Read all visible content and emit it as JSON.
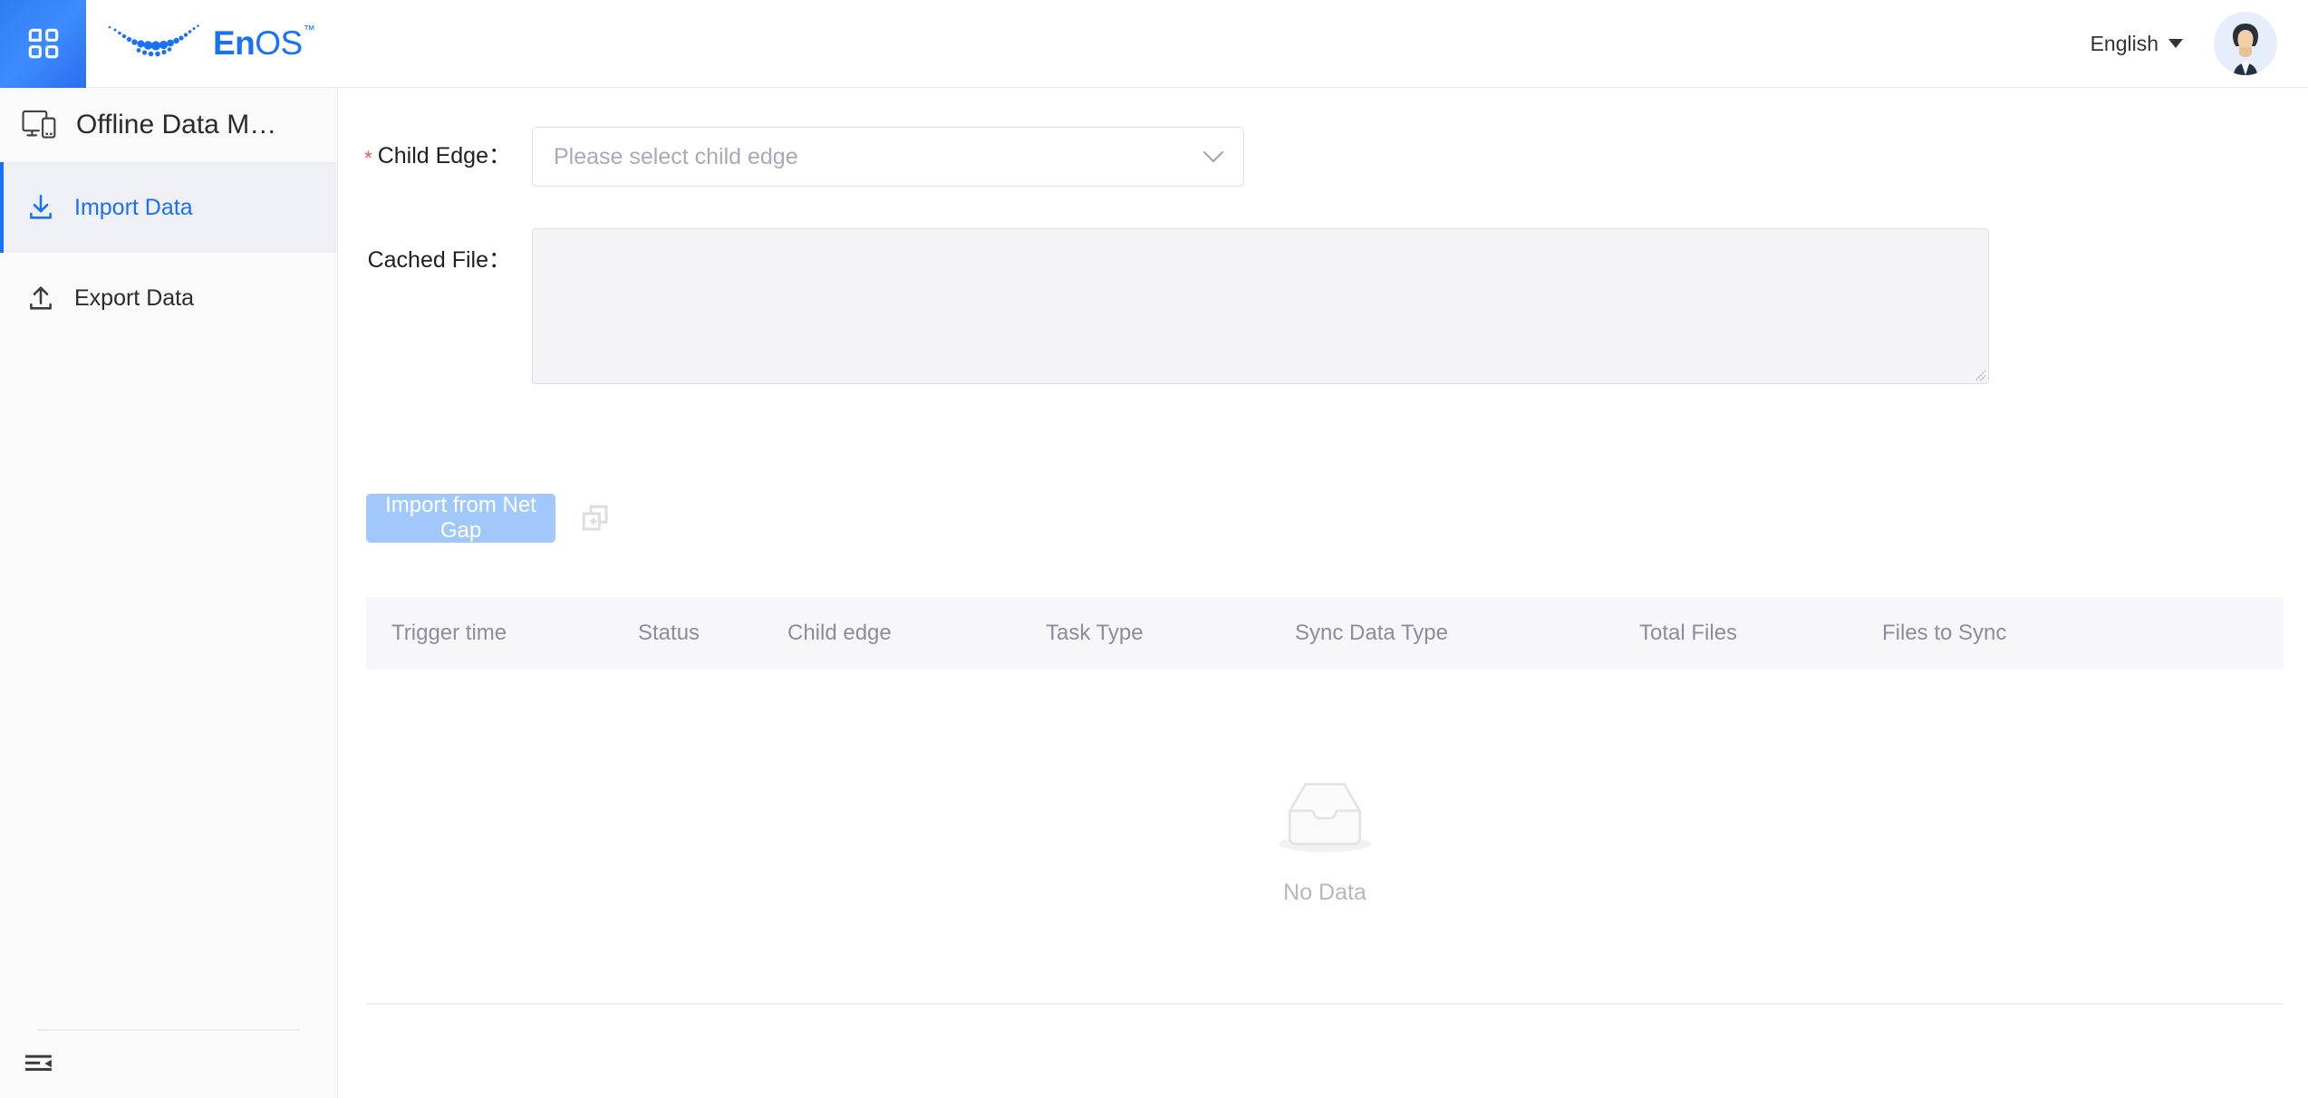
{
  "header": {
    "apps_icon": "apps-grid-icon",
    "brand": {
      "en": "En",
      "os": "OS",
      "tm": "™"
    },
    "language": {
      "label": "English",
      "caret": "chevron-down-icon"
    },
    "avatar_alt": "user-avatar"
  },
  "sidebar": {
    "title": "Offline Data M…",
    "title_icon": "devices-icon",
    "items": [
      {
        "label": "Import Data",
        "icon": "download-icon",
        "active": true
      },
      {
        "label": "Export Data",
        "icon": "upload-icon",
        "active": false
      }
    ],
    "collapse_icon": "collapse-sidebar-icon"
  },
  "form": {
    "child_edge": {
      "required_marker": "*",
      "label": "Child Edge：",
      "placeholder": "Please select child edge",
      "value": ""
    },
    "cached_file": {
      "label": "Cached File：",
      "value": ""
    }
  },
  "actions": {
    "import_button": "Import from Net Gap",
    "copy_icon": "copy-icon"
  },
  "table": {
    "columns": [
      "Trigger time",
      "Status",
      "Child edge",
      "Task Type",
      "Sync Data Type",
      "Total Files",
      "Files to Sync"
    ],
    "rows": [],
    "empty_text": "No Data",
    "empty_icon": "empty-box-icon"
  },
  "colors": {
    "accent": "#1971f5",
    "accent_tile_start": "#2f7df4",
    "accent_tile_end": "#2a6ff0",
    "primary_button": "#a0c8fb",
    "required_star": "#f5514f",
    "table_header_bg": "#f7f7fb",
    "textarea_bg": "#f4f4f8",
    "sidebar_bg": "#fafafa",
    "active_item_bg": "#eef0f6",
    "muted_text": "#8b8d9b",
    "placeholder_text": "#a7aab7"
  }
}
